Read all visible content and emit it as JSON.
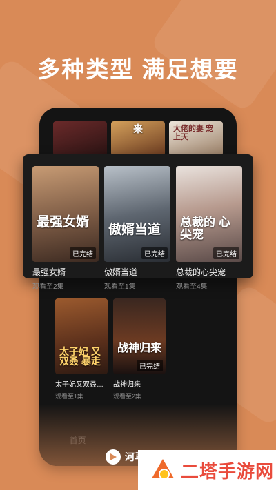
{
  "headline": "多种类型 满足想要",
  "colors": {
    "background": "#d98a57",
    "card": "#1b1b1b",
    "watermark_text": "#e94b3c"
  },
  "top_strip": [
    {
      "name": "top-poster-1",
      "title_art": ""
    },
    {
      "name": "top-poster-2",
      "title_art": "来"
    },
    {
      "name": "top-poster-3",
      "title_art": "大佬的妻 宠上天"
    }
  ],
  "featured_items": [
    {
      "title": "最强女婿",
      "title_art": "最强女婿",
      "badge": "已完结",
      "progress": "观看至2集"
    },
    {
      "title": "傲婿当道",
      "title_art": "傲婿当道",
      "badge": "已完结",
      "progress": "观看至1集"
    },
    {
      "title": "总裁的心尖宠",
      "title_art": "总裁的 心尖宠",
      "badge": "已完结",
      "progress": "观看至4集"
    }
  ],
  "lower_items": [
    {
      "title": "太子妃又双叒…",
      "title_art": "太子妃 又双叒 暴走",
      "badge": "",
      "progress": "观看至1集"
    },
    {
      "title": "战神归来",
      "title_art": "战神归来",
      "badge": "已完结",
      "progress": "观看至2集"
    }
  ],
  "tab_bar": {
    "home": "首页"
  },
  "brand": {
    "name": "河马剧场",
    "logo_icon": "hippo-play-logo-icon"
  },
  "watermark": {
    "text": "二塔手游网"
  }
}
